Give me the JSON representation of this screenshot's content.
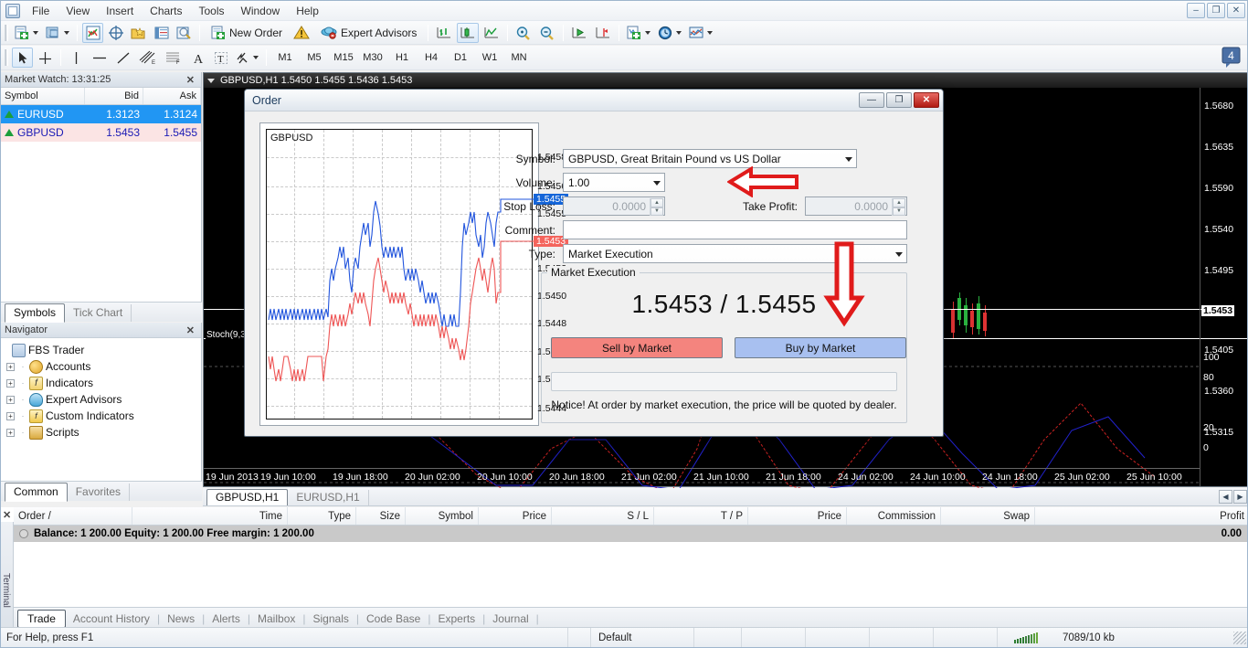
{
  "menu": {
    "items": [
      "File",
      "View",
      "Insert",
      "Charts",
      "Tools",
      "Window",
      "Help"
    ],
    "win_buttons": [
      "–",
      "❐",
      "✕"
    ]
  },
  "toolbar1": {
    "new_order_label": "New Order",
    "expert_advisors_label": "Expert Advisors",
    "icons": [
      "new-chart-icon",
      "profiles-icon",
      "market-watch-icon",
      "data-window-icon",
      "navigator-icon",
      "terminal-icon",
      "strategy-tester-icon",
      "new-order-icon",
      "alert-icon",
      "expert-advisors-icon",
      "bar-chart-icon",
      "candlestick-chart-icon",
      "line-chart-icon",
      "zoom-in-icon",
      "zoom-out-icon",
      "auto-scroll-icon",
      "chart-shift-icon",
      "templates-icon",
      "period-icon",
      "indicators-icon"
    ]
  },
  "toolbar2": {
    "periods": [
      "M1",
      "M5",
      "M15",
      "M30",
      "H1",
      "H4",
      "D1",
      "W1",
      "MN"
    ],
    "active_period": "H1",
    "tools": [
      "cursor-icon",
      "crosshair-icon",
      "vertical-line-icon",
      "horizontal-line-icon",
      "trendline-icon",
      "equidistant-channel-icon",
      "fibonacci-retracement-icon",
      "text-label-icon",
      "text-icon",
      "arrows-icon"
    ],
    "notification_badge": "4"
  },
  "market_watch": {
    "title": "Market Watch: 13:31:25",
    "close": "✕",
    "columns": [
      "Symbol",
      "Bid",
      "Ask"
    ],
    "rows": [
      {
        "symbol": "EURUSD",
        "bid": "1.3123",
        "ask": "1.3124",
        "state": "selected"
      },
      {
        "symbol": "GBPUSD",
        "bid": "1.5453",
        "ask": "1.5455",
        "state": "alt"
      }
    ],
    "tabs": [
      "Symbols",
      "Tick Chart"
    ],
    "active_tab": "Symbols"
  },
  "navigator": {
    "title": "Navigator",
    "close": "✕",
    "root": "FBS Trader",
    "items": [
      "Accounts",
      "Indicators",
      "Expert Advisors",
      "Custom Indicators",
      "Scripts"
    ],
    "tabs": [
      "Common",
      "Favorites"
    ],
    "active_tab": "Common"
  },
  "chart": {
    "caption": "GBPUSD,H1  1.5450 1.5455 1.5436 1.5453",
    "symbol": "GBPUSD",
    "period": "H1",
    "indicator_label": "Stoch(9,3",
    "tabs": [
      "GBPUSD,H1",
      "EURUSD,H1"
    ],
    "active_tab": "GBPUSD,H1",
    "current_price": "1.5453",
    "price_ticks": [
      "1.5680",
      "1.5635",
      "1.5590",
      "1.5540",
      "1.5495",
      "1.5453",
      "1.5405",
      "1.5360",
      "1.5315"
    ],
    "sub_ticks": [
      "100",
      "80",
      "20",
      "0"
    ],
    "time_ticks": [
      "19 Jun 2013",
      "19 Jun 10:00",
      "19 Jun 18:00",
      "20 Jun 02:00",
      "20 Jun 10:00",
      "20 Jun 18:00",
      "21 Jun 02:00",
      "21 Jun 10:00",
      "21 Jun 18:00",
      "24 Jun 02:00",
      "24 Jun 10:00",
      "24 Jun 18:00",
      "25 Jun 02:00",
      "25 Jun 10:00"
    ],
    "scroll_left": "◀",
    "scroll_right": "▶"
  },
  "order_dialog": {
    "title": "Order",
    "buttons": {
      "minimize": "—",
      "maximize": "❐",
      "close": "✕"
    },
    "tick_chart": {
      "symbol": "GBPUSD",
      "ticks": [
        "1.5458",
        "1.5456",
        "1.5455",
        "1.5453",
        "1.5452",
        "1.5450",
        "1.5448",
        "1.5447",
        "1.5445",
        "1.5444"
      ],
      "ask_badge": "1.5455",
      "bid_badge": "1.5453"
    },
    "fields": {
      "symbol_label": "Symbol:",
      "symbol_value": "GBPUSD, Great Britain Pound vs US Dollar",
      "volume_label": "Volume:",
      "volume_value": "1.00",
      "stop_loss_label": "Stop Loss:",
      "stop_loss_value": "0.0000",
      "take_profit_label": "Take Profit:",
      "take_profit_value": "0.0000",
      "comment_label": "Comment:",
      "comment_value": "",
      "type_label": "Type:",
      "type_value": "Market Execution"
    },
    "market_execution": {
      "group_title": "Market Execution",
      "price": "1.5453 / 1.5455",
      "sell_label": "Sell by Market",
      "buy_label": "Buy by Market",
      "status_value": "",
      "notice": "Notice! At order by market execution, the price will be quoted by dealer."
    }
  },
  "terminal": {
    "close": "✕",
    "side_label": "Terminal",
    "columns": [
      "Order  /",
      "Time",
      "Type",
      "Size",
      "Symbol",
      "Price",
      "S / L",
      "T / P",
      "Price",
      "Commission",
      "Swap",
      "Profit"
    ],
    "balance_row": "Balance: 1 200.00  Equity: 1 200.00  Free margin: 1 200.00",
    "profit_total": "0.00",
    "tabs": [
      "Trade",
      "Account History",
      "News",
      "Alerts",
      "Mailbox",
      "Signals",
      "Code Base",
      "Experts",
      "Journal"
    ],
    "active_tab": "Trade"
  },
  "statusbar": {
    "help_text": "For Help, press F1",
    "profile": "Default",
    "traffic": "7089/10 kb",
    "signal_icon": "signal-bars-icon"
  },
  "colors": {
    "accent_blue": "#2196f3",
    "sell_red": "#f4847e",
    "buy_blue": "#a8c0f0",
    "annotation_red": "#e01b1b",
    "bid_red": "#f4645c",
    "ask_blue": "#1565d8"
  }
}
